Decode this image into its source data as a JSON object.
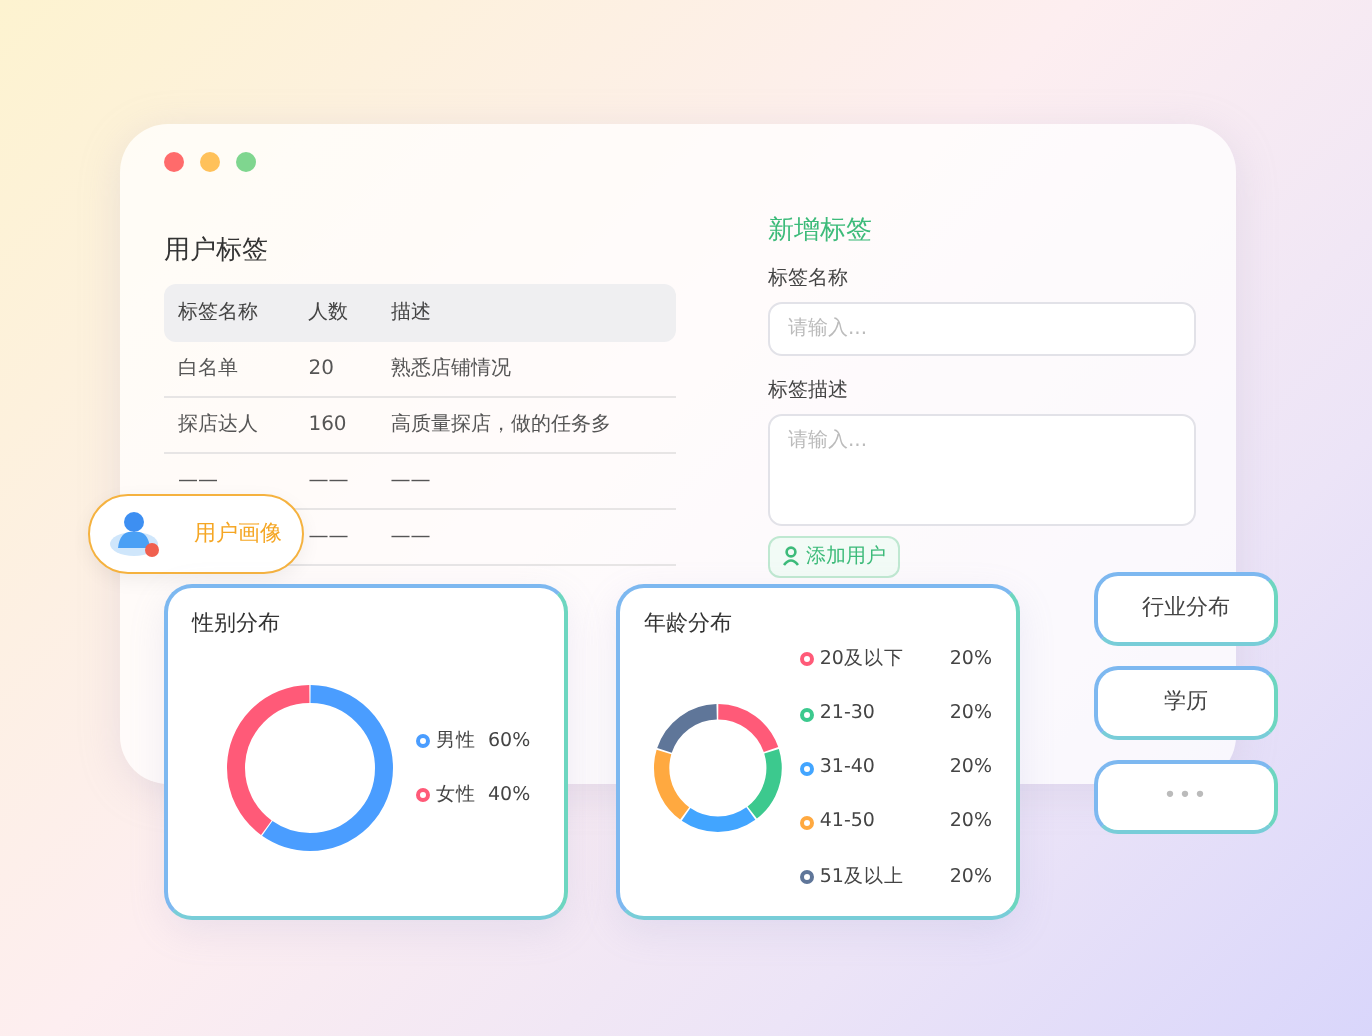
{
  "tag_table": {
    "title": "用户标签",
    "columns": [
      "标签名称",
      "人数",
      "描述"
    ],
    "rows": [
      {
        "cells": [
          "白名单",
          "20",
          "熟悉店铺情况"
        ]
      },
      {
        "cells": [
          "探店达人",
          "160",
          "高质量探店，做的任务多"
        ]
      },
      {
        "cells": [
          "——",
          "——",
          "——"
        ]
      },
      {
        "cells": [
          null,
          "——",
          "——"
        ]
      }
    ]
  },
  "new_tag_form": {
    "title": "新增标签",
    "fields": [
      {
        "label": "标签名称",
        "kind": "input",
        "placeholder": "请输入..."
      },
      {
        "label": "标签描述",
        "kind": "textarea",
        "placeholder": "请输入..."
      }
    ],
    "button": "添加用户"
  },
  "portrait_tab": {
    "label": "用户画像"
  },
  "gender_card": {
    "title": "性别分布",
    "legend": [
      {
        "value": "60%"
      },
      {
        "value": "40%"
      }
    ],
    "chart_data": {
      "type": "donut",
      "categories": [
        "男性",
        "女性"
      ],
      "values": [
        60,
        40
      ],
      "colors": [
        "#4a9dff",
        "#ff5a78"
      ]
    }
  },
  "age_card": {
    "title": "年龄分布",
    "legend": [
      {
        "value": "20%"
      },
      {
        "value": "20%"
      },
      {
        "value": "20%"
      },
      {
        "value": "20%"
      },
      {
        "value": "20%"
      }
    ],
    "chart_data": {
      "type": "donut",
      "categories": [
        "20及以下",
        "21-30",
        "31-40",
        "41-50",
        "51及以上"
      ],
      "values": [
        20,
        20,
        20,
        20,
        20
      ],
      "colors": [
        "#ff5a78",
        "#3cc98e",
        "#42a5ff",
        "#ffa940",
        "#5f7699"
      ]
    }
  },
  "side_buttons": [
    {
      "label": "行业分布",
      "kind": "text"
    },
    {
      "label": "学历",
      "kind": "text"
    },
    {
      "label": "•••",
      "kind": "more"
    }
  ]
}
